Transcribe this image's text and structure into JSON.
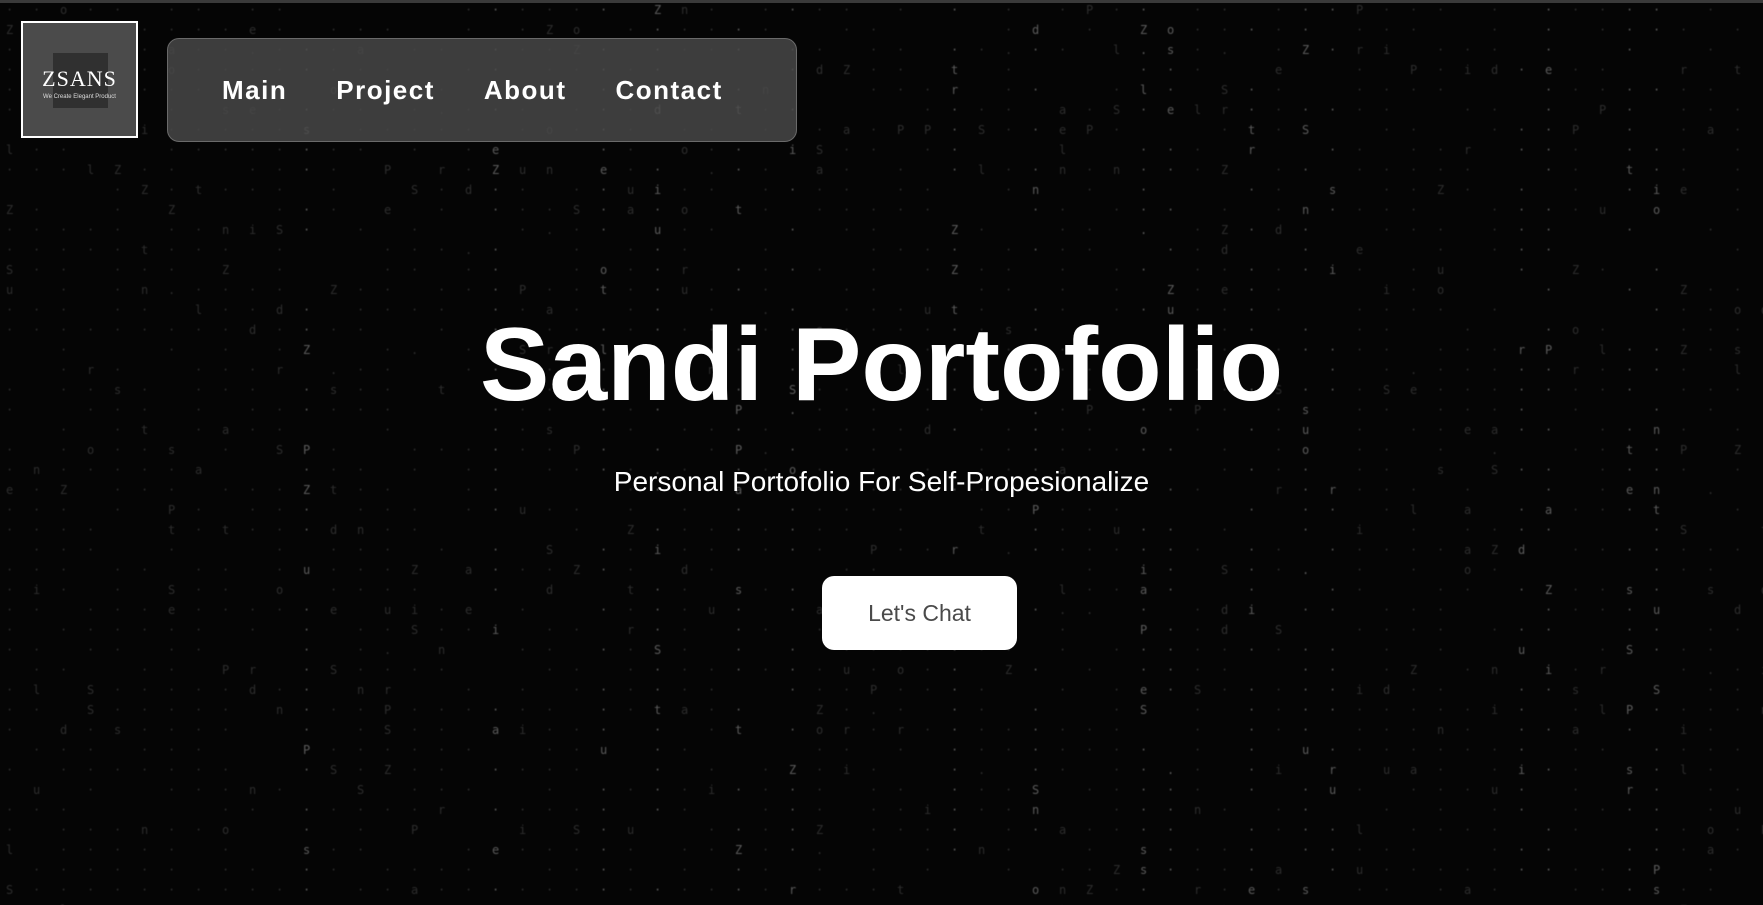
{
  "logo": {
    "brand": "ZSANS",
    "tagline": "We Create Elegant Product"
  },
  "nav": {
    "items": [
      {
        "label": "Main"
      },
      {
        "label": "Project"
      },
      {
        "label": "About"
      },
      {
        "label": "Contact"
      }
    ]
  },
  "hero": {
    "title": "Sandi Portofolio",
    "subtitle": "Personal Portofolio For Self-Propesionalize",
    "cta_label": "Let's Chat"
  },
  "colors": {
    "background": "#050505",
    "nav_background": "#4b4b4b",
    "button_background": "#ffffff",
    "button_text": "#4a4a4a"
  }
}
